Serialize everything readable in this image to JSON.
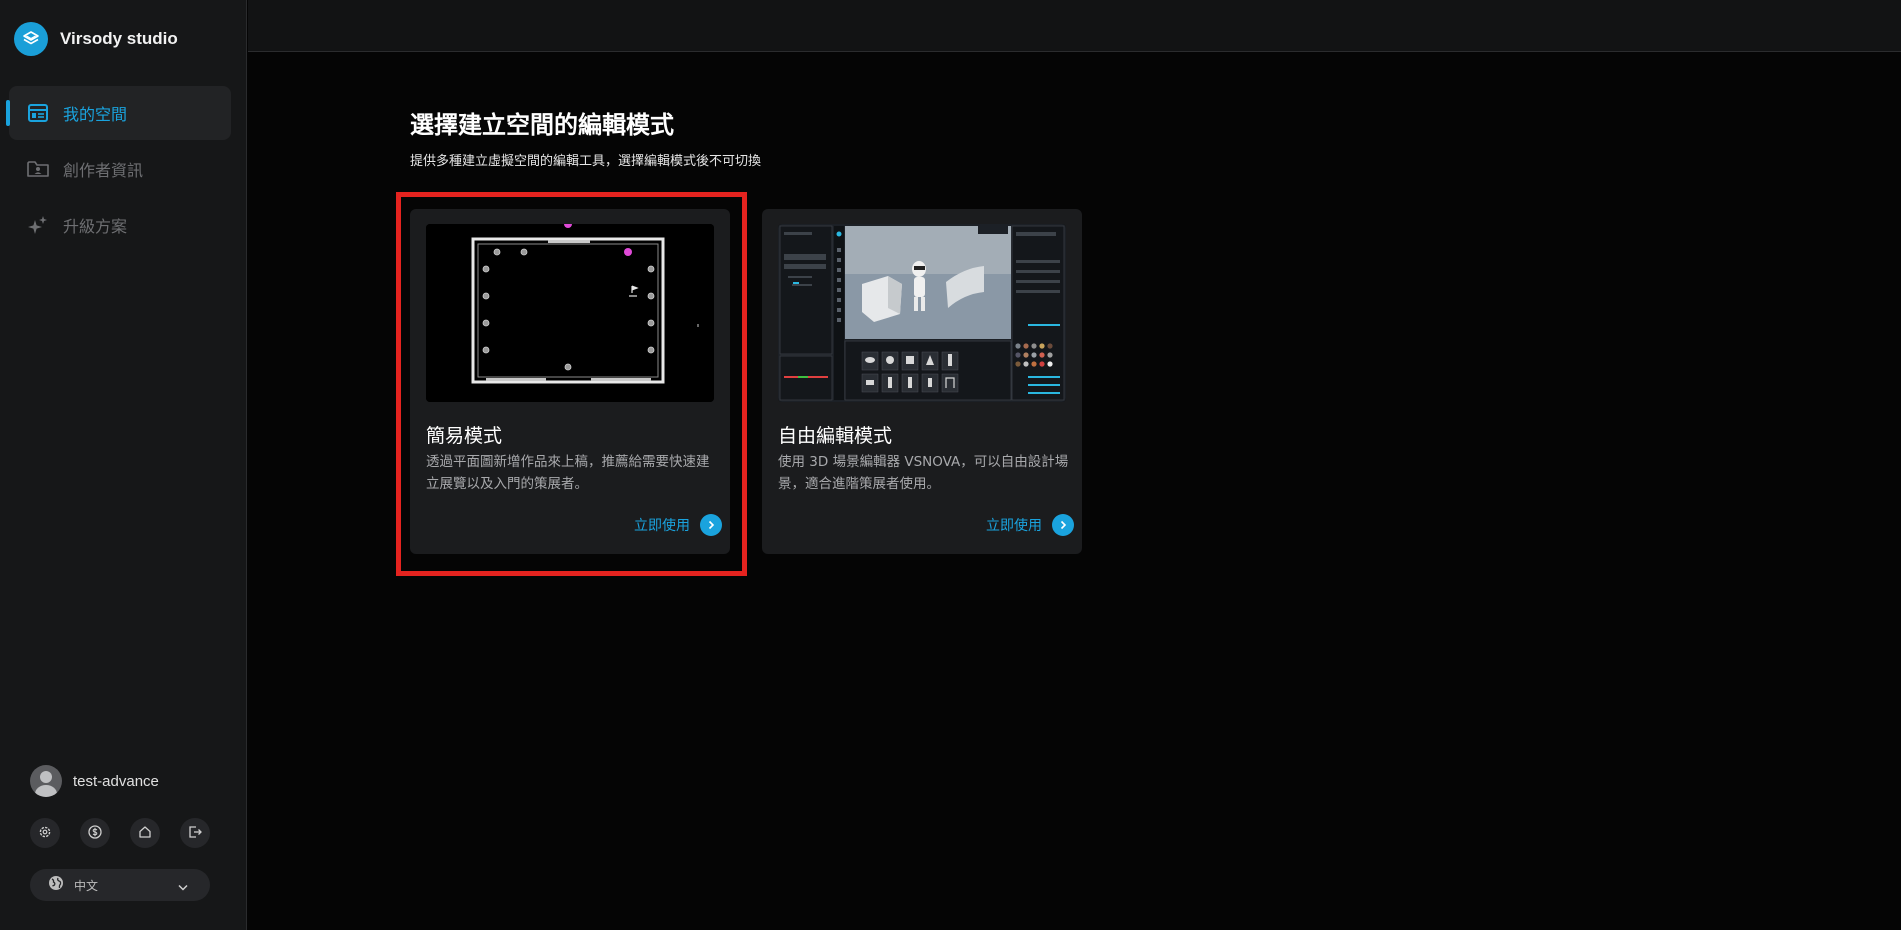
{
  "app": {
    "brand": "Virsody studio"
  },
  "sidebar": {
    "items": [
      {
        "label": "我的空間",
        "icon": "dashboard-icon",
        "active": true
      },
      {
        "label": "創作者資訊",
        "icon": "folder-user-icon",
        "active": false
      },
      {
        "label": "升級方案",
        "icon": "sparkle-icon",
        "active": false
      }
    ],
    "user": {
      "name": "test-advance"
    },
    "utilities": [
      "gear-icon",
      "dollar-icon",
      "home-icon",
      "logout-icon"
    ],
    "language": {
      "label": "中文",
      "icon": "globe-icon"
    }
  },
  "main": {
    "title": "選擇建立空間的編輯模式",
    "subtitle": "提供多種建立虛擬空間的編輯工具，選擇編輯模式後不可切換",
    "cards": [
      {
        "title": "簡易模式",
        "description": "透過平面圖新增作品來上稿，推薦給需要快速建立展覽以及入門的策展者。",
        "cta": "立即使用",
        "selected": true
      },
      {
        "title": "自由編輯模式",
        "description": "使用 3D 場景編輯器 VSNOVA，可以自由設計場景，適合進階策展者使用。",
        "cta": "立即使用",
        "selected": false
      }
    ]
  },
  "colors": {
    "accent": "#1aa3de",
    "highlight": "#e5231f",
    "background": "#050505",
    "sidebar": "#161718"
  }
}
